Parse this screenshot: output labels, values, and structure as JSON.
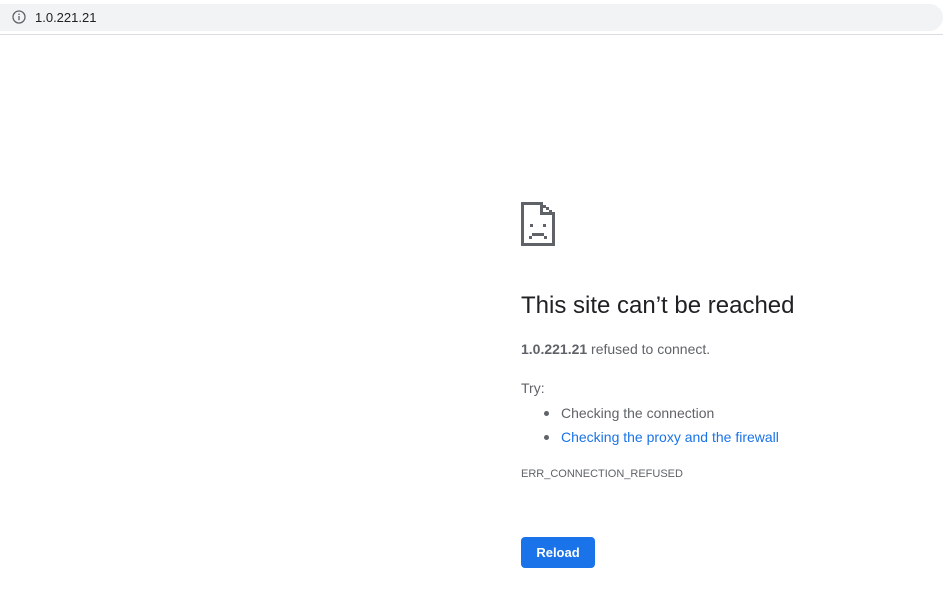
{
  "address_bar": {
    "url": "1.0.221.21",
    "site_info_icon": "info-icon"
  },
  "error_page": {
    "icon": "sad-document-icon",
    "headline": "This site can’t be reached",
    "summary_host": "1.0.221.21",
    "summary_text": " refused to connect.",
    "try_label": "Try:",
    "suggestions": [
      "Checking the connection",
      "Checking the proxy and the firewall"
    ],
    "error_code": "ERR_CONNECTION_REFUSED",
    "reload_label": "Reload"
  },
  "colors": {
    "accent": "#1a73e8",
    "text_primary": "#202124",
    "text_secondary": "#5f6368",
    "omnibox_bg": "#f1f3f4"
  }
}
